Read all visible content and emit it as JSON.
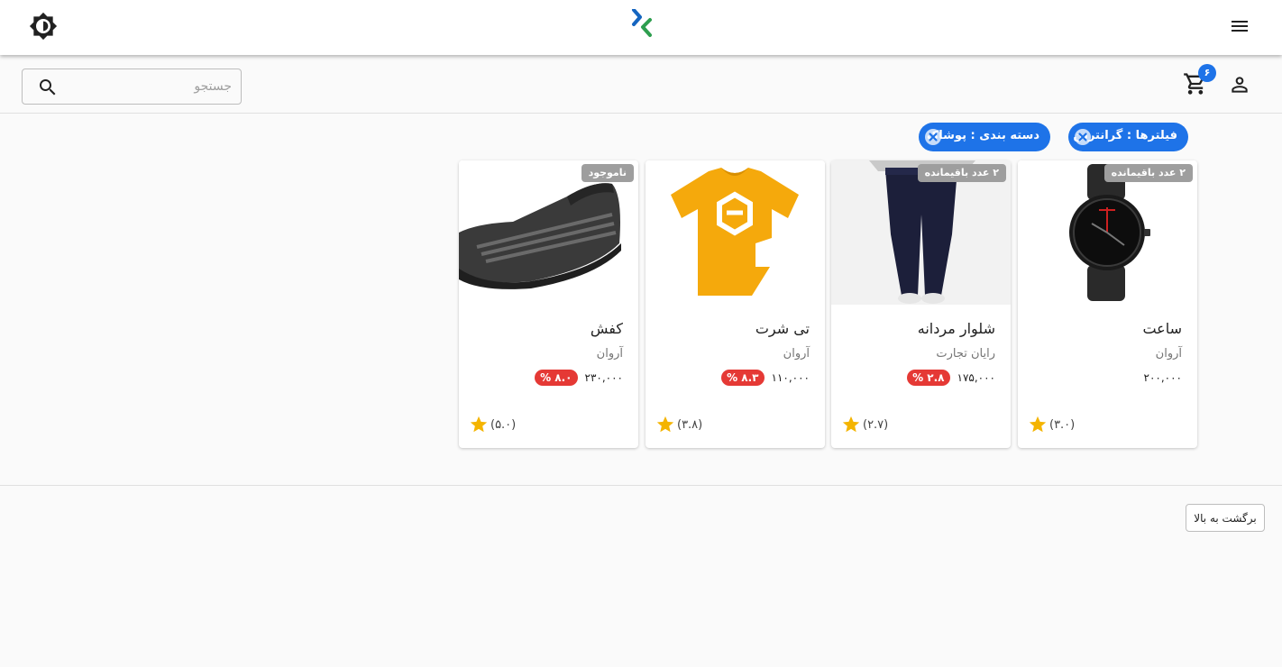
{
  "header": {
    "theme_toggle_icon": "brightness-icon",
    "logo_icon": "brand-logo",
    "menu_icon": "hamburger-menu-icon"
  },
  "toolbar": {
    "search_placeholder": "جستجو",
    "search_icon": "search-icon",
    "cart_icon": "shopping-cart-icon",
    "cart_count": "۶",
    "user_icon": "person-icon"
  },
  "filters": {
    "sort_chip": "فیلترها : گرانترین",
    "category_chip": "دسته بندی : پوشاک"
  },
  "products": [
    {
      "title": "ساعت",
      "brand": "آروان",
      "price": "۲۰۰,۰۰۰",
      "discount": "",
      "rating": "(۳.۰)",
      "stock_badge": "۲ عدد باقیمانده",
      "image": "black-wristwatch"
    },
    {
      "title": "شلوار مردانه",
      "brand": "رایان تجارت",
      "price": "۱۷۵,۰۰۰",
      "discount": "۲.۸ %",
      "rating": "(۲.۷)",
      "stock_badge": "۲ عدد باقیمانده",
      "image": "navy-jogger-pants"
    },
    {
      "title": "تی شرت",
      "brand": "آروان",
      "price": "۱۱۰,۰۰۰",
      "discount": "۸.۳ %",
      "rating": "(۳.۸)",
      "stock_badge": "",
      "image": "yellow-tshirt"
    },
    {
      "title": "کفش",
      "brand": "آروان",
      "price": "۲۳۰,۰۰۰",
      "discount": "۸.۰ %",
      "rating": "(۵.۰)",
      "stock_badge": "ناموجود",
      "image": "gray-knit-sneaker"
    }
  ],
  "footer": {
    "back_to_top": "برگشت به بالا"
  },
  "colors": {
    "primary": "#1e73e8",
    "discount": "#e53935",
    "star": "#f4b400",
    "badge": "#9e9e9e"
  }
}
